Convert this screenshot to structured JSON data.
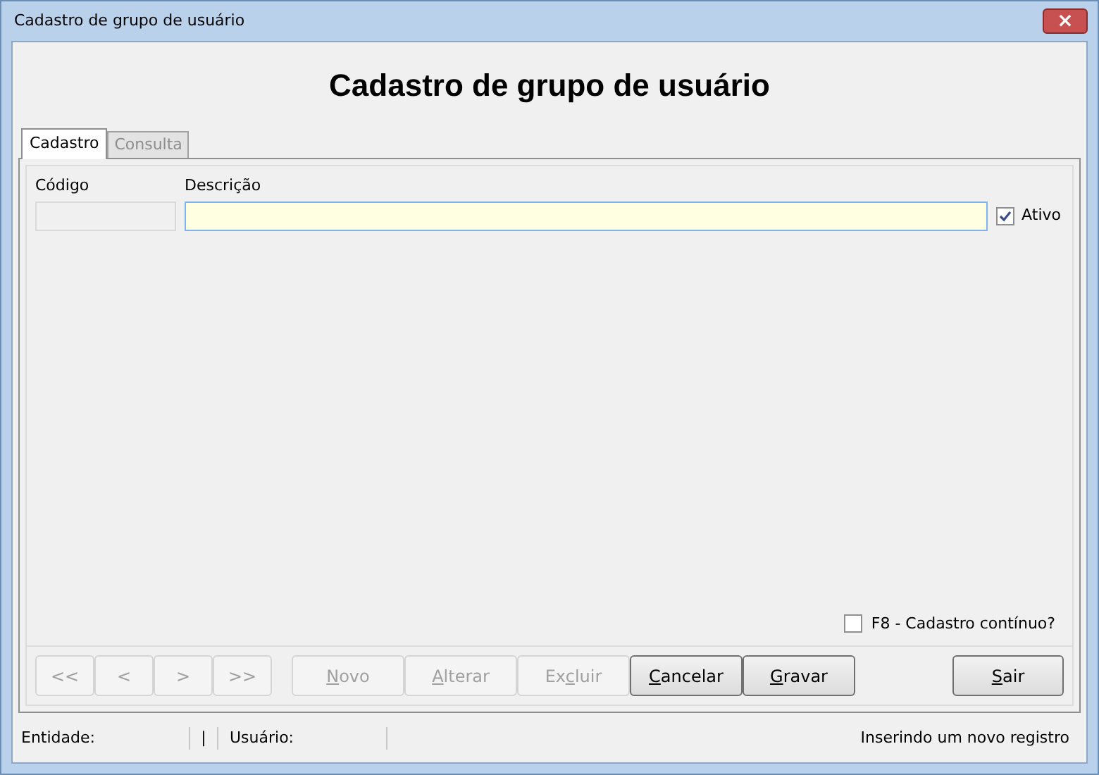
{
  "window": {
    "title": "Cadastro de grupo de usuário",
    "close": "×"
  },
  "heading": "Cadastro de grupo de usuário",
  "tabs": [
    {
      "label": "Cadastro",
      "selected": true
    },
    {
      "label": "Consulta",
      "selected": false
    }
  ],
  "fields": {
    "codigo": {
      "label": "Código",
      "disabled": true
    },
    "descricao": {
      "label": "Descrição",
      "disabled": false
    },
    "ativo": {
      "label": "Ativo",
      "checked": true
    }
  },
  "continuous": {
    "label": "F8 - Cadastro contínuo?",
    "checked": false
  },
  "nav_buttons": [
    {
      "label": "<<",
      "disabled": true
    },
    {
      "label": "<",
      "disabled": true
    },
    {
      "label": ">",
      "disabled": true
    },
    {
      "label": ">>",
      "disabled": true
    }
  ],
  "action_buttons": [
    {
      "key": "N",
      "post": "ovo",
      "disabled": true
    },
    {
      "key": "A",
      "post": "lterar",
      "disabled": true
    },
    {
      "pre": "Ex",
      "key": "c",
      "post": "luir",
      "disabled": true
    },
    {
      "key": "C",
      "post": "ancelar",
      "disabled": false
    },
    {
      "key": "G",
      "post": "ravar",
      "disabled": false
    }
  ],
  "exit_button": {
    "key": "S",
    "post": "air",
    "disabled": false
  },
  "status_bar": {
    "entity": "Entidade:",
    "separator": "|",
    "user": "Usuário:",
    "message": "Inserindo um novo registro"
  }
}
